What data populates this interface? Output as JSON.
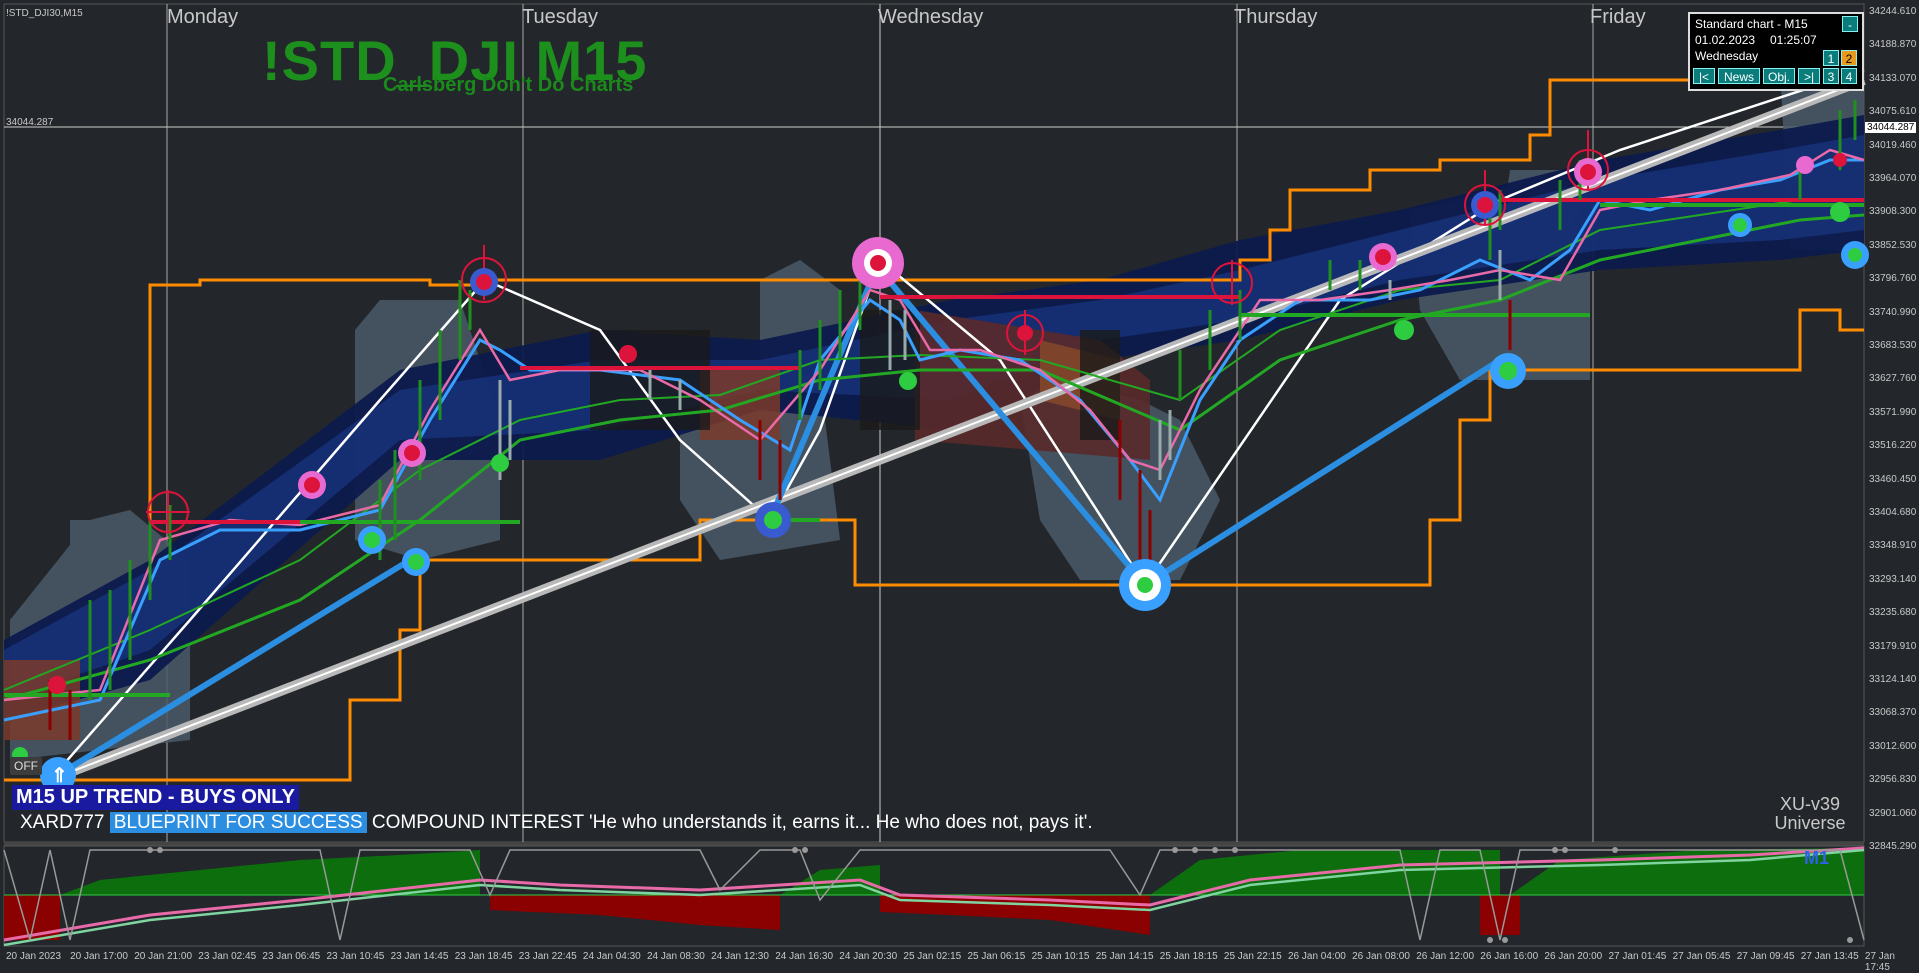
{
  "window": {
    "symbol_label": "!STD_DJI30,M15"
  },
  "header": {
    "title": "!STD_DJI M15",
    "subtitle": "Carlsberg Don't Do Charts"
  },
  "days": [
    "Monday",
    "Tuesday",
    "Wednesday",
    "Thursday",
    "Friday"
  ],
  "crosshair": {
    "price_label": "34044.287",
    "current_price": "34044.287"
  },
  "price_axis": [
    "34244.610",
    "34188.870",
    "34133.070",
    "34075.610",
    "34019.460",
    "33964.070",
    "33908.300",
    "33852.530",
    "33796.760",
    "33740.990",
    "33683.530",
    "33627.760",
    "33571.990",
    "33516.220",
    "33460.450",
    "33404.680",
    "33348.910",
    "33293.140",
    "33235.680",
    "33179.910",
    "33124.140",
    "33068.370",
    "33012.600",
    "32956.830",
    "32901.060",
    "32845.290"
  ],
  "time_axis": [
    "20 Jan 2023",
    "20 Jan 17:00",
    "20 Jan 21:00",
    "23 Jan 02:45",
    "23 Jan 06:45",
    "23 Jan 10:45",
    "23 Jan 14:45",
    "23 Jan 18:45",
    "23 Jan 22:45",
    "24 Jan 04:30",
    "24 Jan 08:30",
    "24 Jan 12:30",
    "24 Jan 16:30",
    "24 Jan 20:30",
    "25 Jan 02:15",
    "25 Jan 06:15",
    "25 Jan 10:15",
    "25 Jan 14:15",
    "25 Jan 18:15",
    "25 Jan 22:15",
    "26 Jan 04:00",
    "26 Jan 08:00",
    "26 Jan 12:00",
    "26 Jan 16:00",
    "26 Jan 20:00",
    "27 Jan 01:45",
    "27 Jan 05:45",
    "27 Jan 09:45",
    "27 Jan 13:45",
    "27 Jan 17:45"
  ],
  "info_panel": {
    "line1": "Standard chart - M15",
    "date": "01.02.2023",
    "time": "01:25:07",
    "weekday": "Wednesday",
    "minimize": "-",
    "buttons": {
      "prev": "|<",
      "news": "News",
      "obj": "Obj.",
      "next": ">|",
      "b1": "1",
      "b2": "2",
      "b3": "3",
      "b4": "4"
    }
  },
  "status": {
    "trend_banner": "M15 UP TREND - BUYS ONLY",
    "quote_name": "XARD777",
    "quote_badge": "BLUEPRINT FOR SUCCESS",
    "quote_text": "COMPOUND INTEREST  'He who understands it, earns it... He who does not, pays it'.",
    "version": "XU-v39",
    "universe": "Universe",
    "off_button": "OFF",
    "sub_label": "M1"
  },
  "colors": {
    "background": "#23272b",
    "bull_candle": "#1f8f1f",
    "bear_candle": "#8b0000",
    "channel_orange": "#ff8c00",
    "band_navy": "#0d1a4d",
    "trend_blue": "#2b8ee0",
    "fast_ma_pink": "#e86aa8",
    "green_ma": "#22a822"
  }
}
